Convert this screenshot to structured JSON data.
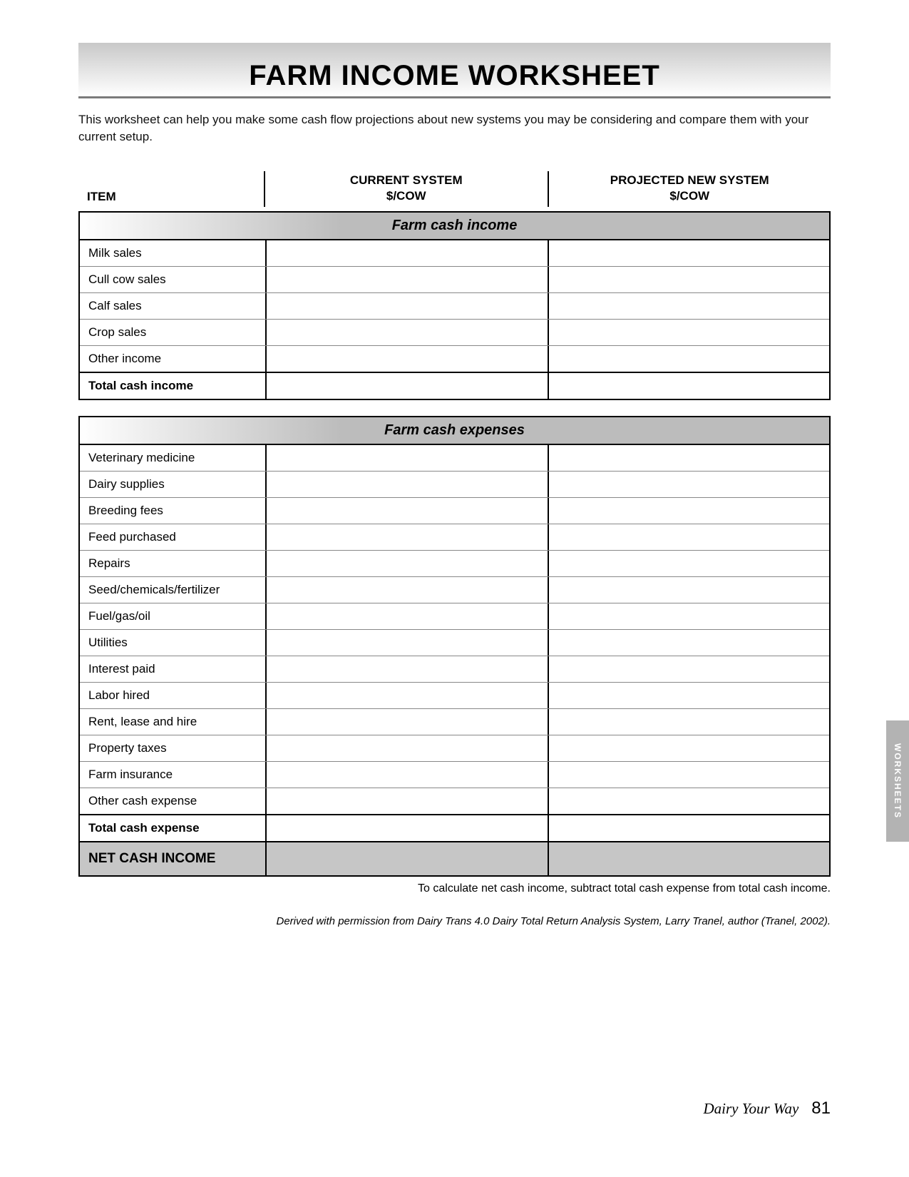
{
  "title": "FARM INCOME WORKSHEET",
  "intro": "This worksheet can help you make some cash flow projections about new systems you may be considering and compare them with your current setup.",
  "columns": {
    "item": "ITEM",
    "current_line1": "CURRENT SYSTEM",
    "current_line2": "$/COW",
    "projected_line1": "PROJECTED NEW SYSTEM",
    "projected_line2": "$/COW"
  },
  "income": {
    "heading": "Farm cash income",
    "rows": [
      {
        "label": "Milk sales",
        "current": "",
        "projected": ""
      },
      {
        "label": "Cull cow sales",
        "current": "",
        "projected": ""
      },
      {
        "label": "Calf sales",
        "current": "",
        "projected": ""
      },
      {
        "label": "Crop sales",
        "current": "",
        "projected": ""
      },
      {
        "label": "Other income",
        "current": "",
        "projected": ""
      }
    ],
    "total": {
      "label": "Total cash income",
      "current": "",
      "projected": ""
    }
  },
  "expenses": {
    "heading": "Farm cash expenses",
    "rows": [
      {
        "label": "Veterinary medicine",
        "current": "",
        "projected": ""
      },
      {
        "label": "Dairy supplies",
        "current": "",
        "projected": ""
      },
      {
        "label": "Breeding fees",
        "current": "",
        "projected": ""
      },
      {
        "label": "Feed purchased",
        "current": "",
        "projected": ""
      },
      {
        "label": "Repairs",
        "current": "",
        "projected": ""
      },
      {
        "label": "Seed/chemicals/fertilizer",
        "current": "",
        "projected": ""
      },
      {
        "label": "Fuel/gas/oil",
        "current": "",
        "projected": ""
      },
      {
        "label": "Utilities",
        "current": "",
        "projected": ""
      },
      {
        "label": "Interest paid",
        "current": "",
        "projected": ""
      },
      {
        "label": "Labor hired",
        "current": "",
        "projected": ""
      },
      {
        "label": "Rent, lease and hire",
        "current": "",
        "projected": ""
      },
      {
        "label": "Property taxes",
        "current": "",
        "projected": ""
      },
      {
        "label": "Farm insurance",
        "current": "",
        "projected": ""
      },
      {
        "label": "Other cash expense",
        "current": "",
        "projected": ""
      }
    ],
    "total": {
      "label": "Total cash expense",
      "current": "",
      "projected": ""
    },
    "net": {
      "label": "NET CASH INCOME",
      "current": "",
      "projected": ""
    }
  },
  "note": "To calculate net cash income, subtract total cash expense from total cash income.",
  "attribution": "Derived with permission from Dairy Trans 4.0 Dairy Total Return Analysis System, Larry Tranel, author (Tranel, 2002).",
  "side_tab": "WORKSHEETS",
  "footer": {
    "book_title": "Dairy Your Way",
    "page_number": "81"
  }
}
